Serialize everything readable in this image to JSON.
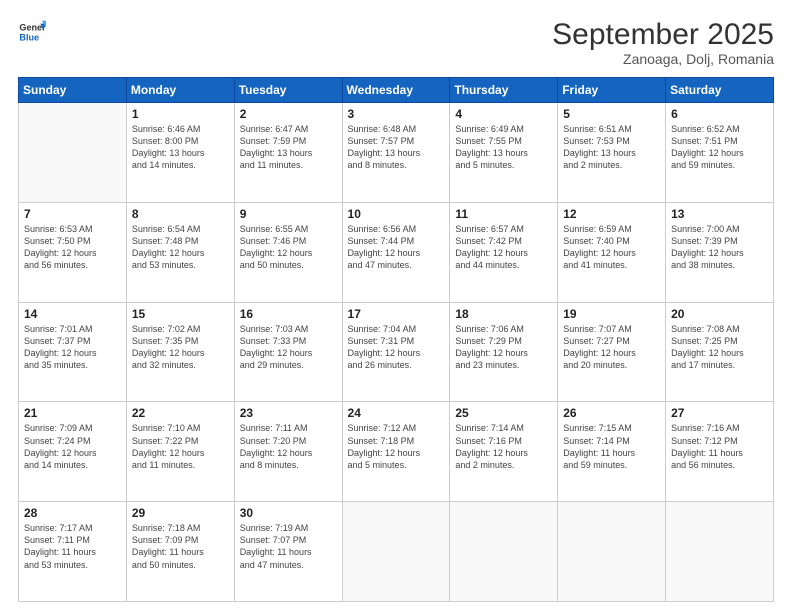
{
  "header": {
    "logo_line1": "General",
    "logo_line2": "Blue",
    "title": "September 2025",
    "subtitle": "Zanoaga, Dolj, Romania"
  },
  "weekdays": [
    "Sunday",
    "Monday",
    "Tuesday",
    "Wednesday",
    "Thursday",
    "Friday",
    "Saturday"
  ],
  "weeks": [
    [
      {
        "day": "",
        "info": ""
      },
      {
        "day": "1",
        "info": "Sunrise: 6:46 AM\nSunset: 8:00 PM\nDaylight: 13 hours\nand 14 minutes."
      },
      {
        "day": "2",
        "info": "Sunrise: 6:47 AM\nSunset: 7:59 PM\nDaylight: 13 hours\nand 11 minutes."
      },
      {
        "day": "3",
        "info": "Sunrise: 6:48 AM\nSunset: 7:57 PM\nDaylight: 13 hours\nand 8 minutes."
      },
      {
        "day": "4",
        "info": "Sunrise: 6:49 AM\nSunset: 7:55 PM\nDaylight: 13 hours\nand 5 minutes."
      },
      {
        "day": "5",
        "info": "Sunrise: 6:51 AM\nSunset: 7:53 PM\nDaylight: 13 hours\nand 2 minutes."
      },
      {
        "day": "6",
        "info": "Sunrise: 6:52 AM\nSunset: 7:51 PM\nDaylight: 12 hours\nand 59 minutes."
      }
    ],
    [
      {
        "day": "7",
        "info": "Sunrise: 6:53 AM\nSunset: 7:50 PM\nDaylight: 12 hours\nand 56 minutes."
      },
      {
        "day": "8",
        "info": "Sunrise: 6:54 AM\nSunset: 7:48 PM\nDaylight: 12 hours\nand 53 minutes."
      },
      {
        "day": "9",
        "info": "Sunrise: 6:55 AM\nSunset: 7:46 PM\nDaylight: 12 hours\nand 50 minutes."
      },
      {
        "day": "10",
        "info": "Sunrise: 6:56 AM\nSunset: 7:44 PM\nDaylight: 12 hours\nand 47 minutes."
      },
      {
        "day": "11",
        "info": "Sunrise: 6:57 AM\nSunset: 7:42 PM\nDaylight: 12 hours\nand 44 minutes."
      },
      {
        "day": "12",
        "info": "Sunrise: 6:59 AM\nSunset: 7:40 PM\nDaylight: 12 hours\nand 41 minutes."
      },
      {
        "day": "13",
        "info": "Sunrise: 7:00 AM\nSunset: 7:39 PM\nDaylight: 12 hours\nand 38 minutes."
      }
    ],
    [
      {
        "day": "14",
        "info": "Sunrise: 7:01 AM\nSunset: 7:37 PM\nDaylight: 12 hours\nand 35 minutes."
      },
      {
        "day": "15",
        "info": "Sunrise: 7:02 AM\nSunset: 7:35 PM\nDaylight: 12 hours\nand 32 minutes."
      },
      {
        "day": "16",
        "info": "Sunrise: 7:03 AM\nSunset: 7:33 PM\nDaylight: 12 hours\nand 29 minutes."
      },
      {
        "day": "17",
        "info": "Sunrise: 7:04 AM\nSunset: 7:31 PM\nDaylight: 12 hours\nand 26 minutes."
      },
      {
        "day": "18",
        "info": "Sunrise: 7:06 AM\nSunset: 7:29 PM\nDaylight: 12 hours\nand 23 minutes."
      },
      {
        "day": "19",
        "info": "Sunrise: 7:07 AM\nSunset: 7:27 PM\nDaylight: 12 hours\nand 20 minutes."
      },
      {
        "day": "20",
        "info": "Sunrise: 7:08 AM\nSunset: 7:25 PM\nDaylight: 12 hours\nand 17 minutes."
      }
    ],
    [
      {
        "day": "21",
        "info": "Sunrise: 7:09 AM\nSunset: 7:24 PM\nDaylight: 12 hours\nand 14 minutes."
      },
      {
        "day": "22",
        "info": "Sunrise: 7:10 AM\nSunset: 7:22 PM\nDaylight: 12 hours\nand 11 minutes."
      },
      {
        "day": "23",
        "info": "Sunrise: 7:11 AM\nSunset: 7:20 PM\nDaylight: 12 hours\nand 8 minutes."
      },
      {
        "day": "24",
        "info": "Sunrise: 7:12 AM\nSunset: 7:18 PM\nDaylight: 12 hours\nand 5 minutes."
      },
      {
        "day": "25",
        "info": "Sunrise: 7:14 AM\nSunset: 7:16 PM\nDaylight: 12 hours\nand 2 minutes."
      },
      {
        "day": "26",
        "info": "Sunrise: 7:15 AM\nSunset: 7:14 PM\nDaylight: 11 hours\nand 59 minutes."
      },
      {
        "day": "27",
        "info": "Sunrise: 7:16 AM\nSunset: 7:12 PM\nDaylight: 11 hours\nand 56 minutes."
      }
    ],
    [
      {
        "day": "28",
        "info": "Sunrise: 7:17 AM\nSunset: 7:11 PM\nDaylight: 11 hours\nand 53 minutes."
      },
      {
        "day": "29",
        "info": "Sunrise: 7:18 AM\nSunset: 7:09 PM\nDaylight: 11 hours\nand 50 minutes."
      },
      {
        "day": "30",
        "info": "Sunrise: 7:19 AM\nSunset: 7:07 PM\nDaylight: 11 hours\nand 47 minutes."
      },
      {
        "day": "",
        "info": ""
      },
      {
        "day": "",
        "info": ""
      },
      {
        "day": "",
        "info": ""
      },
      {
        "day": "",
        "info": ""
      }
    ]
  ]
}
